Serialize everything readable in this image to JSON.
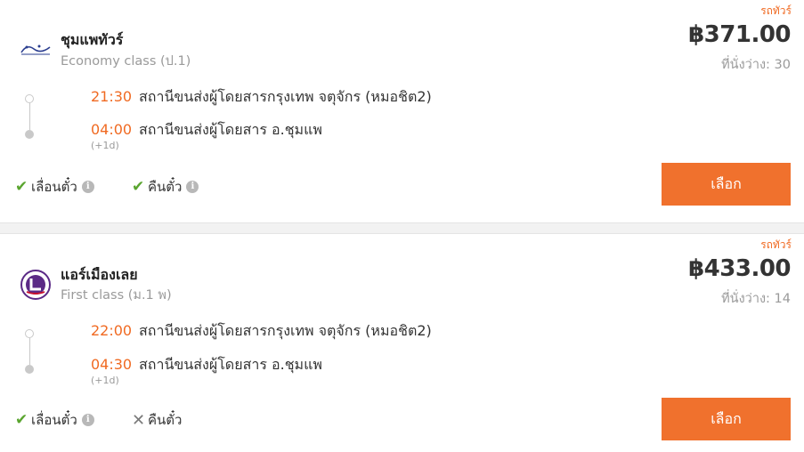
{
  "colors": {
    "accent": "#f06a22",
    "button": "#f0712d",
    "check": "#5aa52f",
    "muted": "#9a9a9a"
  },
  "select_label": "เลือก",
  "trips": [
    {
      "badge": "รถทัวร์",
      "operator_name": "ชุมแพทัวร์",
      "logo_text": "ชุมแพทัวร์",
      "class": "Economy class (ป.1)",
      "price": "฿371.00",
      "seats": "ที่นั่งว่าง: 30",
      "departure_time": "21:30",
      "departure_station": "สถานีขนส่งผู้โดยสารกรุงเทพ จตุจักร (หมอชิต2)",
      "arrival_time": "04:00",
      "arrival_station": "สถานีขนส่งผู้โดยสาร อ.ชุมแพ",
      "next_day": "(+1d)",
      "change_label": "เลื่อนตั๋ว",
      "change_allowed": true,
      "refund_label": "คืนตั๋ว",
      "refund_allowed": true,
      "logo_icon": "bus-operator-logo"
    },
    {
      "badge": "รถทัวร์",
      "operator_name": "แอร์เมืองเลย",
      "class": "First class (ม.1 พ)",
      "price": "฿433.00",
      "seats": "ที่นั่งว่าง: 14",
      "departure_time": "22:00",
      "departure_station": "สถานีขนส่งผู้โดยสารกรุงเทพ จตุจักร (หมอชิต2)",
      "arrival_time": "04:30",
      "arrival_station": "สถานีขนส่งผู้โดยสาร อ.ชุมแพ",
      "next_day": "(+1d)",
      "change_label": "เลื่อนตั๋ว",
      "change_allowed": true,
      "refund_label": "คืนตั๋ว",
      "refund_allowed": false,
      "logo_icon": "bus-operator-logo"
    }
  ],
  "icons": {
    "check": "✔",
    "cross": "✕",
    "info": "i"
  }
}
